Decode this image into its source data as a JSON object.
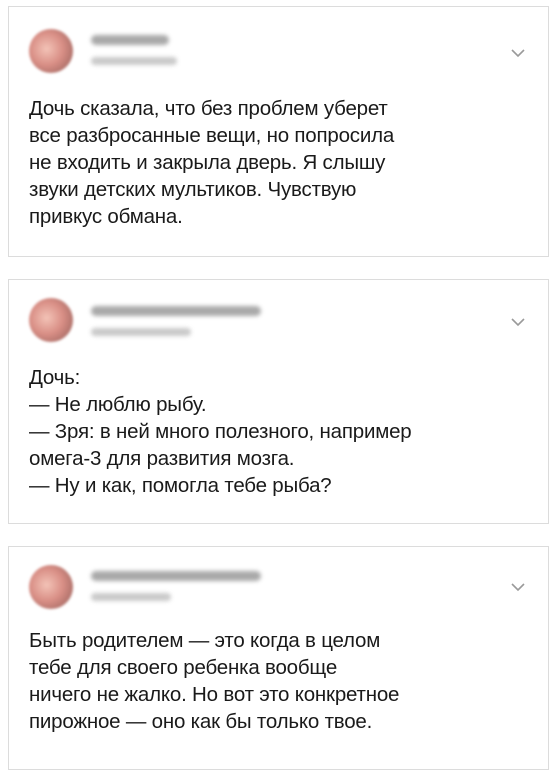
{
  "posts": [
    {
      "lines": [
        "Дочь сказала, что без проблем уберет",
        "все разбросанные вещи, но попросила",
        "не входить и закрыла дверь. Я слышу",
        "звуки детских мультиков. Чувствую",
        "привкус обмана."
      ]
    },
    {
      "lines": [
        "Дочь:",
        "— Не люблю рыбу.",
        "— Зря: в ней много полезного, например",
        "омега-3 для развития мозга.",
        "— Ну и как, помогла тебе рыба?"
      ]
    },
    {
      "lines": [
        "Быть родителем — это когда в целом",
        "тебе для своего ребенка вообще",
        "ничего не жалко. Но вот это конкретное",
        "пирожное — оно как бы только твое."
      ]
    }
  ],
  "icons": {
    "menu": "chevron-down-icon",
    "avatar": "avatar-photo"
  },
  "colors": {
    "text": "#1a1a1a",
    "border": "#dcdcdc",
    "chevron": "#9a9a9a"
  }
}
